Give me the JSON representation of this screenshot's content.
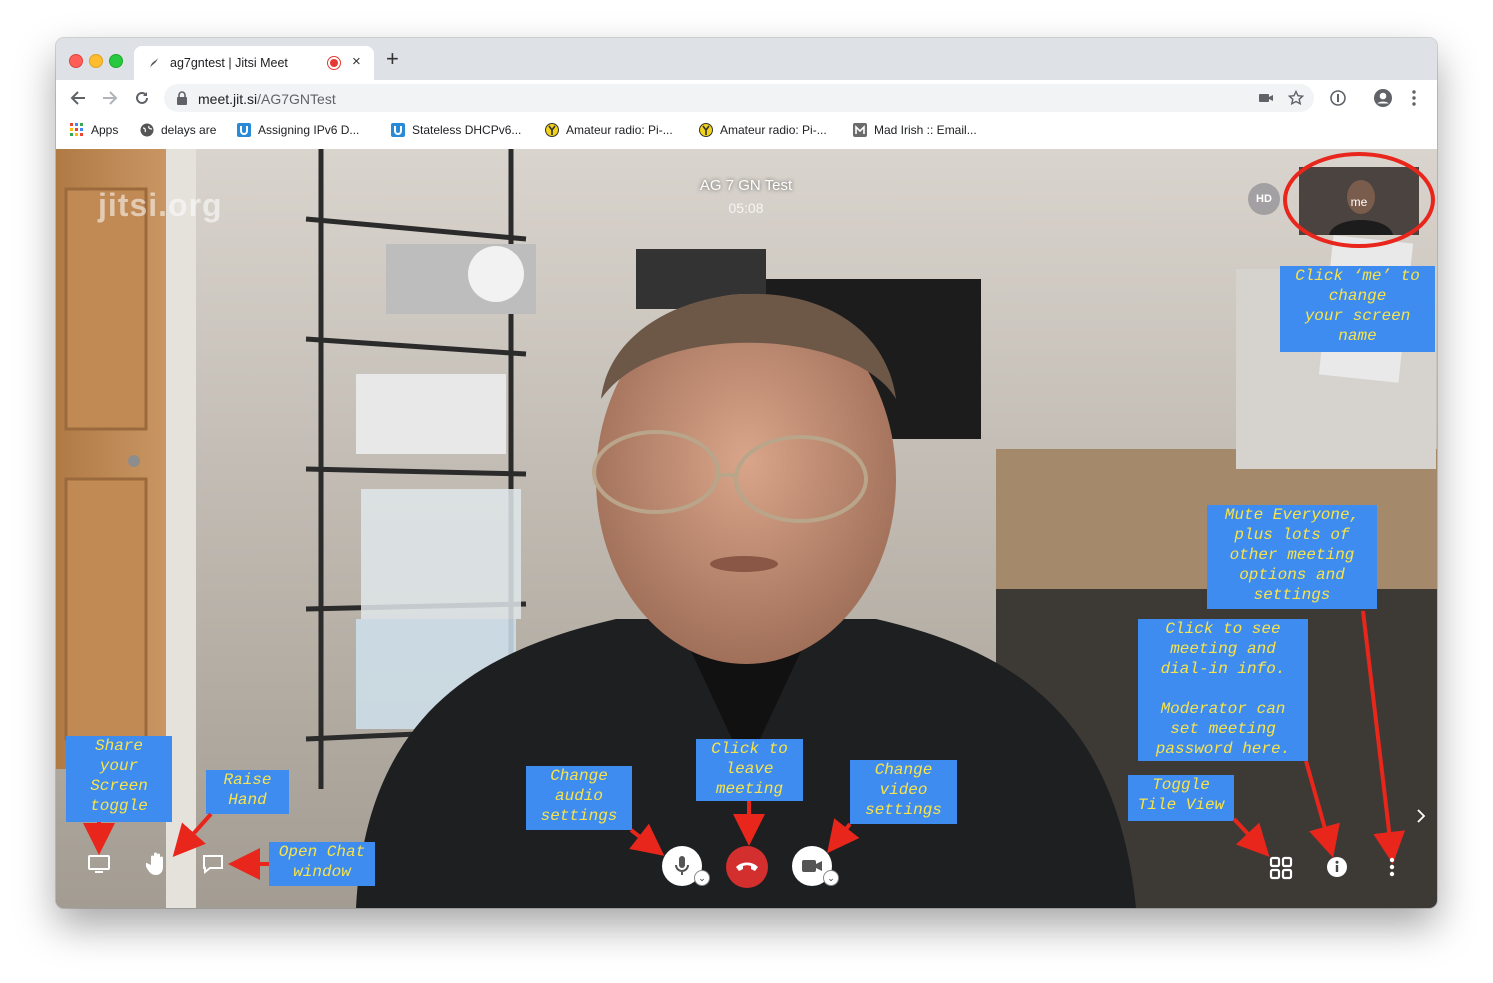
{
  "browser": {
    "tab_title": "ag7gntest | Jitsi Meet",
    "tab_close": "×",
    "new_tab": "+",
    "url_host": "meet.jit.si",
    "url_path": "/AG7GNTest",
    "bookmarks": [
      {
        "label": "Apps",
        "icon": "apps-grid-icon"
      },
      {
        "label": "delays are",
        "icon": "globe-icon"
      },
      {
        "label": "Assigning IPv6 D...",
        "icon": "u-badge-icon"
      },
      {
        "label": "Stateless DHCPv6...",
        "icon": "u-badge-icon"
      },
      {
        "label": "Amateur radio: Pi-...",
        "icon": "yellow-y-icon"
      },
      {
        "label": "Amateur radio: Pi-...",
        "icon": "yellow-y-icon"
      },
      {
        "label": "Mad Irish :: Email...",
        "icon": "m-badge-icon"
      }
    ]
  },
  "meeting": {
    "title": "AG 7 GN Test",
    "timer": "05:08",
    "watermark": "jitsi.org",
    "hd_badge": "HD",
    "self_label": "me"
  },
  "annotations": {
    "change_name": "Click ‘me’ to\nchange\nyour screen\nname",
    "mute_everyone": "Mute Everyone,\nplus lots of\nother meeting\noptions and\nsettings",
    "meeting_info": "Click to see\nmeeting and\ndial-in info.\n\nModerator can\nset meeting\npassword here.",
    "toggle_tile": "Toggle\nTile View",
    "share_screen": "Share\nyour\nScreen\ntoggle",
    "raise_hand": "Raise\nHand",
    "open_chat": "Open Chat\nwindow",
    "audio_settings": "Change\naudio\nsettings",
    "leave_meeting": "Click to\nleave\nmeeting",
    "video_settings": "Change\nvideo\nsettings"
  },
  "colors": {
    "annotation_bg": "#3f8cf0",
    "annotation_text": "#f7e34b",
    "arrow": "#e8261c",
    "hangup": "#d32f2f"
  }
}
